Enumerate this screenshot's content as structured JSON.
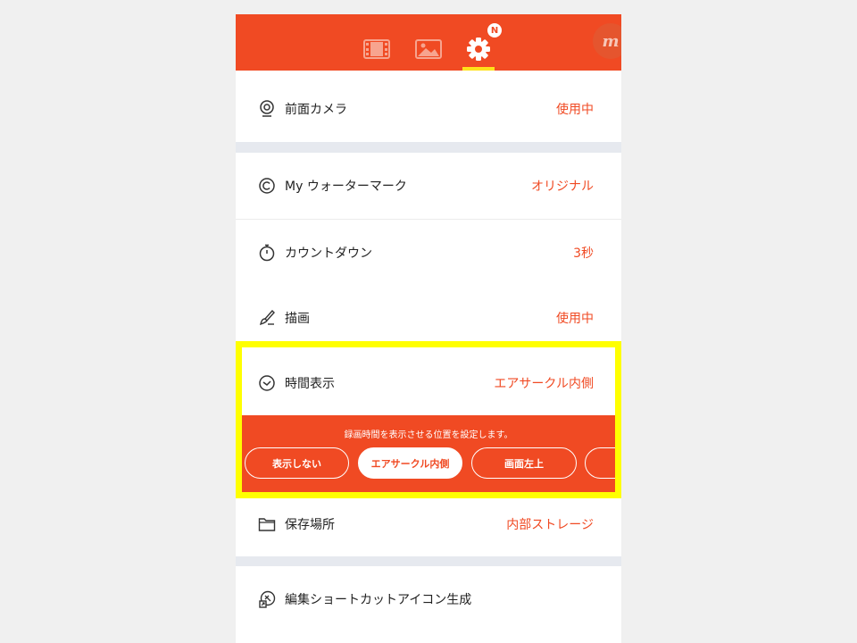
{
  "colors": {
    "accent": "#f04a23",
    "highlight": "#ffff00",
    "tab_underline": "#ffe11a",
    "section_gap": "#e6e9ef"
  },
  "topbar": {
    "tabs": [
      {
        "icon": "film-icon"
      },
      {
        "icon": "image-icon"
      },
      {
        "icon": "gear-icon",
        "active": true
      }
    ],
    "badge": "N",
    "logo_text": "m"
  },
  "settings": {
    "front_camera": {
      "icon": "camera-icon",
      "label": "前面カメラ",
      "value": "使用中"
    },
    "watermark": {
      "icon": "copyright-icon",
      "label": "My ウォーターマーク",
      "value": "オリジナル"
    },
    "countdown": {
      "icon": "stopwatch-icon",
      "label": "カウントダウン",
      "value": "3秒"
    },
    "drawing": {
      "icon": "brush-icon",
      "label": "描画",
      "value": "使用中"
    },
    "time_display": {
      "icon": "clock-icon",
      "label": "時間表示",
      "value": "エアサークル内側"
    },
    "storage": {
      "icon": "folder-icon",
      "label": "保存場所",
      "value": "内部ストレージ"
    },
    "shortcut": {
      "icon": "shortcut-icon",
      "label": "編集ショートカットアイコン生成"
    }
  },
  "time_panel": {
    "description": "録画時間を表示させる位置を設定します。",
    "options": [
      "表示しない",
      "エアサークル内側",
      "画面左上"
    ],
    "selected": "エアサークル内側"
  }
}
